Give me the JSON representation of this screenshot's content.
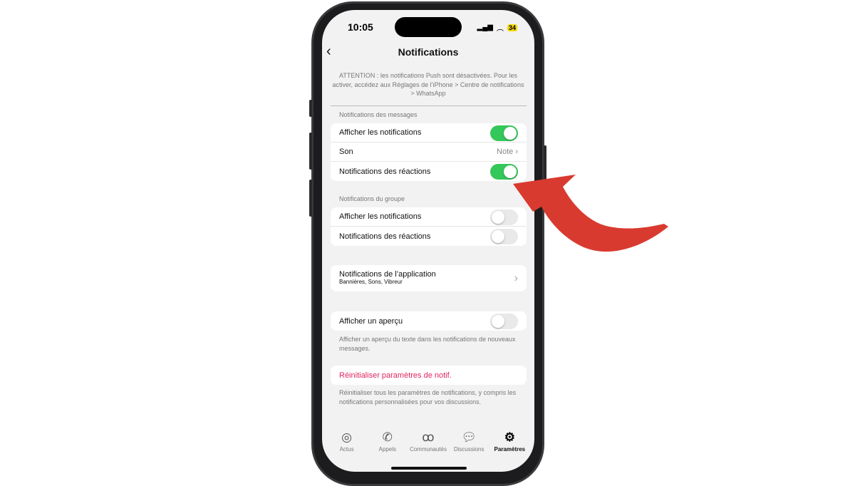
{
  "status": {
    "time": "10:05",
    "battery": "34"
  },
  "header": {
    "title": "Notifications",
    "back": "‹"
  },
  "warning": "ATTENTION : les notifications Push sont désactivées. Pour les activer, accédez aux Réglages de l’iPhone > Centre de notifications > WhatsApp",
  "messages": {
    "title": "Notifications des messages",
    "show": "Afficher les notifications",
    "show_on": true,
    "sound": "Son",
    "sound_value": "Note",
    "reactions": "Notifications des réactions",
    "reactions_on": true
  },
  "group": {
    "title": "Notifications du groupe",
    "show": "Afficher les notifications",
    "show_on": false,
    "reactions": "Notifications des réactions",
    "reactions_on": false
  },
  "app": {
    "title": "Notifications de l’application",
    "subtitle": "Bannières, Sons, Vibreur"
  },
  "preview": {
    "label": "Afficher un aperçu",
    "on": false,
    "note": "Afficher un aperçu du texte dans les notifications de nouveaux messages."
  },
  "reset": {
    "label": "Réinitialiser paramètres de notif.",
    "color": "#e0245e",
    "note": "Réinitialiser tous les paramètres de notifications, y compris les notifications personnalisées pour vos discussions."
  },
  "tabs": [
    {
      "label": "Actus"
    },
    {
      "label": "Appels"
    },
    {
      "label": "Communautés"
    },
    {
      "label": "Discussions"
    },
    {
      "label": "Paramètres",
      "active": true
    }
  ],
  "annotation": {
    "arrow_color": "#d93a2f"
  }
}
